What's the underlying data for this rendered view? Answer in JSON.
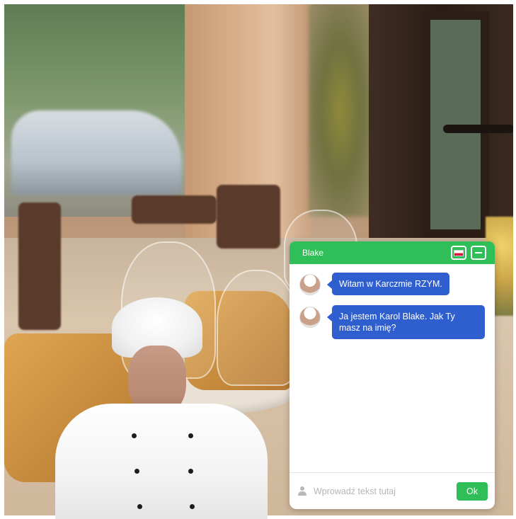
{
  "chat": {
    "header": {
      "title": "Blake",
      "language_flag_icon": "poland-flag-icon",
      "minimize_icon": "minimize-icon"
    },
    "messages": [
      {
        "sender": "bot",
        "avatar_icon": "chef-avatar-icon",
        "text": "Witam w Karczmie RZYM."
      },
      {
        "sender": "bot",
        "avatar_icon": "chef-avatar-icon",
        "text": "Ja jestem Karol Blake. Jak Ty masz na imię?"
      }
    ],
    "input": {
      "placeholder": "Wprowadź tekst tutaj",
      "value": "",
      "user_icon": "user-icon",
      "submit_label": "Ok"
    },
    "colors": {
      "accent": "#2fbe57",
      "bubble": "#2f5fcf"
    }
  },
  "background": {
    "scene": "restaurant-table-image",
    "character": "chef-avatar-image"
  }
}
